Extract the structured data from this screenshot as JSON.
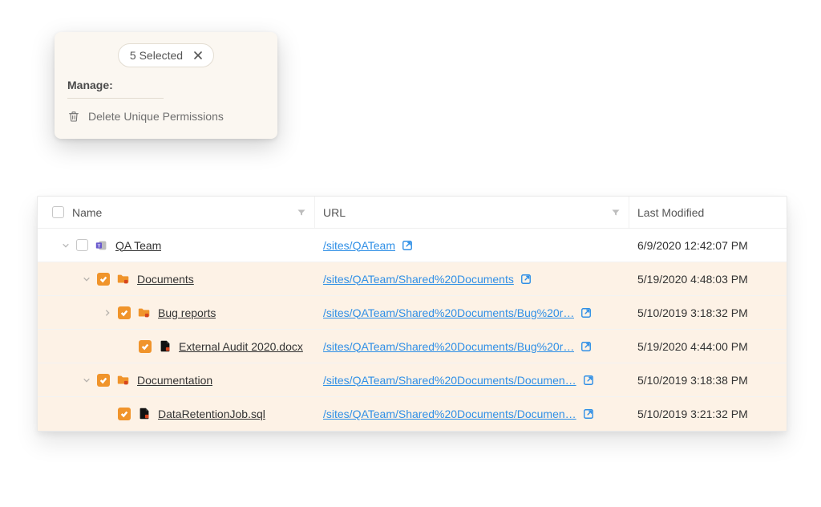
{
  "popover": {
    "selected_label": "5 Selected",
    "manage_label": "Manage:",
    "delete_label": "Delete Unique Permissions"
  },
  "columns": {
    "name": "Name",
    "url": "URL",
    "modified": "Last Modified"
  },
  "rows": [
    {
      "depth": 0,
      "caret": "down",
      "selected": false,
      "checkbox": "empty",
      "icon": "teams",
      "name": "QA Team",
      "url": "/sites/QATeam",
      "url_truncated": false,
      "modified": "6/9/2020 12:42:07 PM"
    },
    {
      "depth": 1,
      "caret": "down",
      "selected": true,
      "checkbox": "on",
      "icon": "folder",
      "name": "Documents",
      "url": "/sites/QATeam/Shared%20Documents",
      "url_truncated": false,
      "modified": "5/19/2020 4:48:03 PM"
    },
    {
      "depth": 2,
      "caret": "right",
      "selected": true,
      "checkbox": "on",
      "icon": "folder",
      "name": "Bug reports",
      "url": "/sites/QATeam/Shared%20Documents/Bug%20r…",
      "url_truncated": true,
      "modified": "5/10/2019 3:18:32 PM"
    },
    {
      "depth": 3,
      "caret": "none",
      "selected": true,
      "checkbox": "on",
      "icon": "file-dark",
      "name": "External Audit 2020.docx",
      "url": "/sites/QATeam/Shared%20Documents/Bug%20r…",
      "url_truncated": true,
      "modified": "5/19/2020 4:44:00 PM"
    },
    {
      "depth": 1,
      "caret": "down",
      "selected": true,
      "checkbox": "on",
      "icon": "folder",
      "name": "Documentation",
      "url": "/sites/QATeam/Shared%20Documents/Documen…",
      "url_truncated": true,
      "modified": "5/10/2019 3:18:38 PM"
    },
    {
      "depth": 2,
      "caret": "none",
      "selected": true,
      "checkbox": "on",
      "icon": "file-dark",
      "name": "DataRetentionJob.sql",
      "url": "/sites/QATeam/Shared%20Documents/Documen…",
      "url_truncated": true,
      "modified": "5/10/2019 3:21:32 PM"
    }
  ]
}
